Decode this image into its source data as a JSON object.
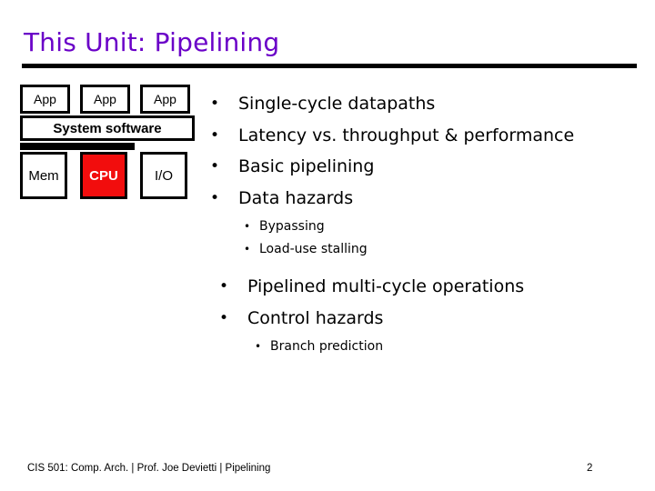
{
  "slide": {
    "title": "This Unit: Pipelining",
    "title_color": "#6a00c8",
    "background_color": "#ffffff"
  },
  "diagram": {
    "name": "system-stack-diagram",
    "app_boxes": [
      {
        "label": "App"
      },
      {
        "label": "App"
      },
      {
        "label": "App"
      }
    ],
    "system_software": {
      "label": "System software"
    },
    "bus": {
      "label": ""
    },
    "hardware_boxes": [
      {
        "label": "Mem",
        "highlight": false
      },
      {
        "label": "CPU",
        "highlight": true,
        "fill_color": "#f20d0d",
        "text_color": "#ffffff"
      },
      {
        "label": "I/O",
        "highlight": false
      }
    ]
  },
  "content": {
    "group_a": [
      {
        "level": 1,
        "marker": "•",
        "text": "Single-cycle datapaths"
      },
      {
        "level": 1,
        "marker": "•",
        "text": "Latency vs. throughput & performance"
      },
      {
        "level": 1,
        "marker": "•",
        "text": "Basic pipelining"
      },
      {
        "level": 1,
        "marker": "•",
        "text": "Data hazards"
      },
      {
        "level": 2,
        "marker": "•",
        "text": "Bypassing"
      },
      {
        "level": 2,
        "marker": "•",
        "text": "Load-use stalling"
      }
    ],
    "group_b": [
      {
        "level": 1,
        "marker": "•",
        "text": "Pipelined multi-cycle operations"
      },
      {
        "level": 1,
        "marker": "•",
        "text": "Control hazards"
      },
      {
        "level": 2,
        "marker": "•",
        "text": "Branch prediction"
      }
    ]
  },
  "footer": {
    "text": "CIS 501: Comp. Arch.  |  Prof. Joe Devietti  |  Pipelining",
    "page_number": "2"
  }
}
